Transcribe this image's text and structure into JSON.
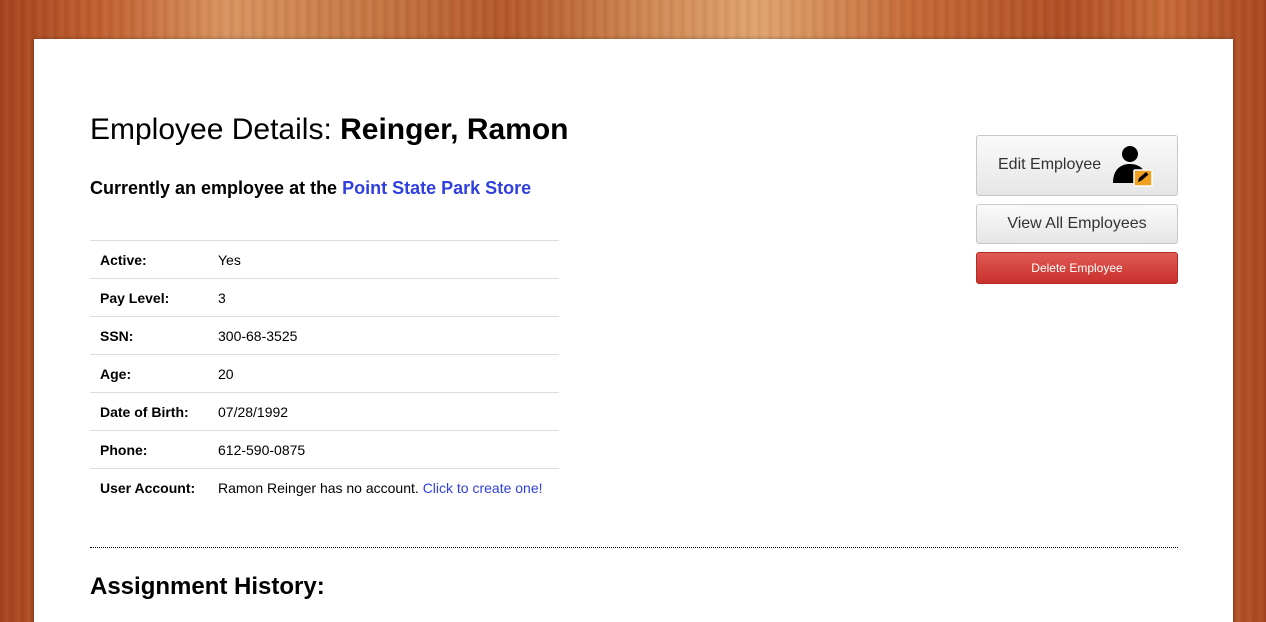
{
  "header": {
    "title_prefix": "Employee Details:",
    "employee_name": "Reinger, Ramon",
    "employment_prefix": "Currently an employee at the",
    "store_link": "Point State Park Store"
  },
  "details": {
    "rows": [
      {
        "label": "Active:",
        "value": "Yes"
      },
      {
        "label": "Pay Level:",
        "value": "3"
      },
      {
        "label": "SSN:",
        "value": "300-68-3525"
      },
      {
        "label": "Age:",
        "value": "20"
      },
      {
        "label": "Date of Birth:",
        "value": "07/28/1992"
      },
      {
        "label": "Phone:",
        "value": "612-590-0875"
      }
    ],
    "user_account": {
      "label": "User Account:",
      "text": "Ramon Reinger has no account.",
      "link": "Click to create one!"
    }
  },
  "actions": {
    "edit_label": "Edit Employee",
    "edit_icon": "user-edit-icon",
    "view_all_label": "View All Employees",
    "delete_label": "Delete Employee"
  },
  "sections": {
    "assignment_history": "Assignment History:"
  },
  "colors": {
    "link": "#3040e0",
    "danger": "#d9534f",
    "edit_badge": "#f0a020"
  }
}
